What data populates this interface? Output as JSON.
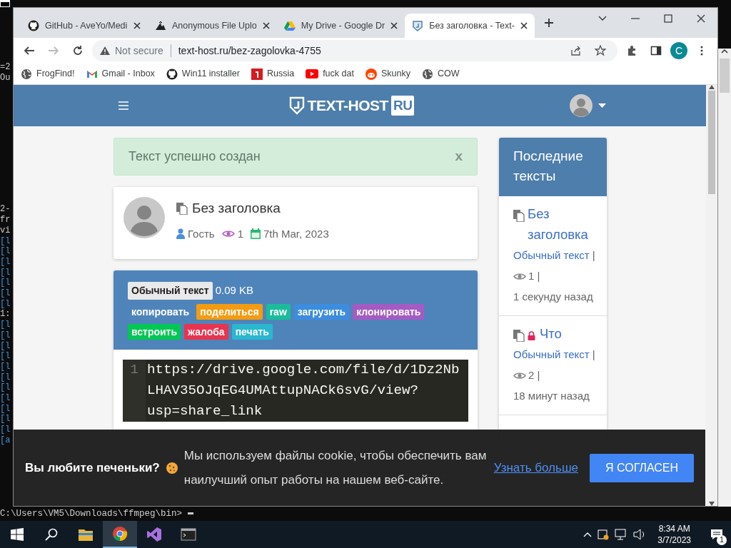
{
  "console": {
    "blocks": [
      [
        "=2",
        "Ou"
      ],
      [
        "2-"
      ],
      [
        "fr",
        "vi",
        "[l",
        "[l",
        "[l",
        "[l",
        "[l",
        "[l",
        "[l",
        "1:",
        "[l",
        "[l",
        "[l",
        "[l",
        "[l",
        "[l",
        "[l",
        "[l",
        "[l",
        "[l",
        "[l",
        "[a"
      ]
    ],
    "prompt": "C:\\Users\\VM5\\Downloads\\ffmpeg\\bin>"
  },
  "browser": {
    "tabs": [
      {
        "title": "GitHub - AveYo/Medi",
        "kind": "github",
        "selected": false
      },
      {
        "title": "Anonymous File Uplo",
        "kind": "upload",
        "selected": false
      },
      {
        "title": "My Drive - Google Dr",
        "kind": "drive",
        "selected": false
      },
      {
        "title": "Без заголовка - Text-",
        "kind": "site",
        "selected": true
      }
    ],
    "security": "Not secure",
    "url": "text-host.ru/bez-zagolovka-4755",
    "profile_initial": "C",
    "bookmarks": [
      {
        "label": "FrogFind!",
        "kind": "globe"
      },
      {
        "label": "Gmail - Inbox",
        "kind": "gmail"
      },
      {
        "label": "Win11 installer",
        "kind": "github"
      },
      {
        "label": "Russia",
        "kind": "red"
      },
      {
        "label": "fuck dat",
        "kind": "youtube"
      },
      {
        "label": "Skunky",
        "kind": "reddit"
      },
      {
        "label": "COW",
        "kind": "globe"
      }
    ]
  },
  "page": {
    "logo": "TEXT-HOST",
    "logo_badge": "RU",
    "alert": {
      "text": "Текст успешно создан",
      "close": "x"
    },
    "paste": {
      "title": "Без заголовка",
      "author": "Гость",
      "views": "1",
      "date": "7th Mar, 2023",
      "syntax": "Обычный текст",
      "size": "0.09 KB",
      "actions": [
        {
          "label": "копировать",
          "color": "#4f84bb"
        },
        {
          "label": "поделиться",
          "color": "#f39c12"
        },
        {
          "label": "raw",
          "color": "#1abc9c"
        },
        {
          "label": "загрузить",
          "color": "#3c8dde"
        },
        {
          "label": "клонировать",
          "color": "#a55bc4"
        },
        {
          "label": "встроить",
          "color": "#00c853"
        },
        {
          "label": "жалоба",
          "color": "#e8344e"
        },
        {
          "label": "печать",
          "color": "#2ab7cf"
        }
      ],
      "code_lines": [
        {
          "number": "1",
          "text": "https://drive.google.com/file/d/1Dz2NbLHAV35OJqEG4UMAttupNACk6svG/view?usp=share_link"
        }
      ]
    },
    "sidebar": {
      "title": "Последние тексты",
      "items": [
        {
          "title": "Без заголовка",
          "locked": false,
          "syntax": "Обычный текст",
          "separators": [
            "|",
            "|"
          ],
          "views": "1",
          "time": "1 секунду назад"
        },
        {
          "title": "Что",
          "locked": true,
          "syntax": "Обычный текст",
          "separators": [
            "|",
            "|"
          ],
          "views": "2",
          "time": "18 минут назад"
        }
      ]
    },
    "cookie": {
      "heading": "Вы любите печеньки?",
      "text": "Мы используем файлы cookie, чтобы обеспечить вам наилучший опыт работы на нашем веб-сайте.",
      "link": "Узнать больше",
      "button": "Я СОГЛАСЕН"
    }
  },
  "taskbar": {
    "apps": [
      {
        "kind": "folder",
        "selected": false
      },
      {
        "kind": "chrome",
        "selected": true
      },
      {
        "kind": "vs",
        "selected": false
      },
      {
        "kind": "terminal",
        "selected": false
      }
    ],
    "time": "8:34 AM",
    "date": "3/7/2023",
    "notification_count": "1"
  }
}
